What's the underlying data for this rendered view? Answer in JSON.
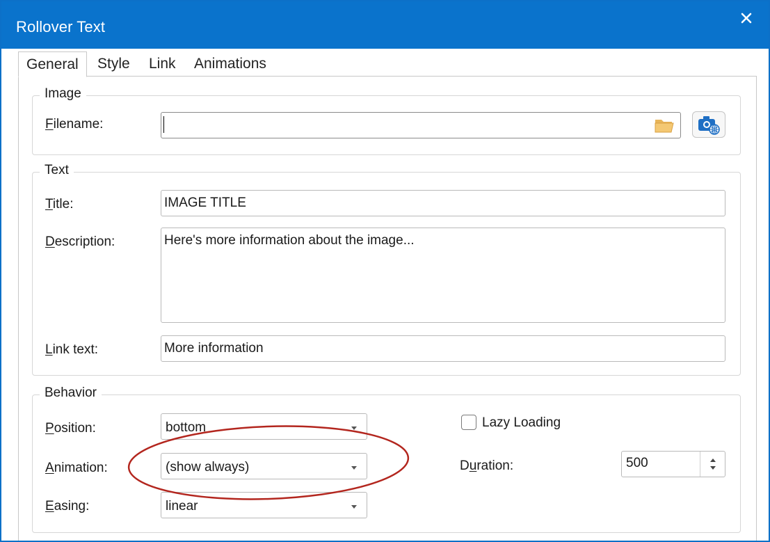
{
  "window": {
    "title": "Rollover Text",
    "close_icon": "close-icon"
  },
  "tabs": [
    {
      "label": "General",
      "active": true
    },
    {
      "label": "Style",
      "active": false
    },
    {
      "label": "Link",
      "active": false
    },
    {
      "label": "Animations",
      "active": false
    }
  ],
  "image_group": {
    "legend": "Image",
    "filename_label_accel": "F",
    "filename_label_rest": "ilename:",
    "filename_value": "",
    "browse_icon": "folder-open-icon",
    "online_icon": "camera-web-icon"
  },
  "text_group": {
    "legend": "Text",
    "title_label_accel": "T",
    "title_label_rest": "itle:",
    "title_value": "IMAGE TITLE",
    "description_label_accel": "D",
    "description_label_rest": "escription:",
    "description_value": "Here's more information about the image...",
    "linktext_label_accel": "L",
    "linktext_label_rest": "ink text:",
    "linktext_value": "More information"
  },
  "behavior_group": {
    "legend": "Behavior",
    "position_label_accel": "P",
    "position_label_rest": "osition:",
    "position_value": "bottom",
    "animation_label_accel": "A",
    "animation_label_rest": "nimation:",
    "animation_value": "(show always)",
    "easing_label_accel": "E",
    "easing_label_rest": "asing:",
    "easing_value": "linear",
    "lazy_loading_label": "Lazy Loading",
    "lazy_loading_checked": false,
    "duration_label_pre": "D",
    "duration_label_accel": "u",
    "duration_label_rest": "ration:",
    "duration_value": "500"
  },
  "colors": {
    "titlebar": "#0a73cc",
    "highlight_ellipse": "#b3261e"
  }
}
